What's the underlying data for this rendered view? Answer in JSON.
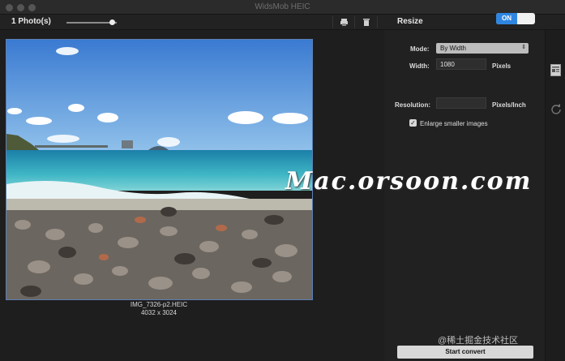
{
  "window": {
    "title": "WidsMob HEIC"
  },
  "toolbar": {
    "photo_count": "1 Photo(s)",
    "slider_value": 0.9
  },
  "panel": {
    "section_title": "Resize",
    "toggle_label": "ON",
    "mode_label": "Mode:",
    "mode_value": "By Width",
    "width_label": "Width:",
    "width_value": "1080",
    "width_unit": "Pixels",
    "resolution_label": "Resolution:",
    "resolution_value": "",
    "resolution_unit": "Pixels/Inch",
    "enlarge_label": "Enlarge smaller images",
    "enlarge_checked": true
  },
  "photo": {
    "filename": "IMG_7326-p2.HEIC",
    "dimensions": "4032 x 3024"
  },
  "overlay": {
    "watermark": "Mac.orsoon.com",
    "credit": "@稀土掘金技术社区"
  },
  "actions": {
    "start_label": "Start convert"
  },
  "colors": {
    "accent": "#2f86e0",
    "background": "#1e1e1e"
  }
}
